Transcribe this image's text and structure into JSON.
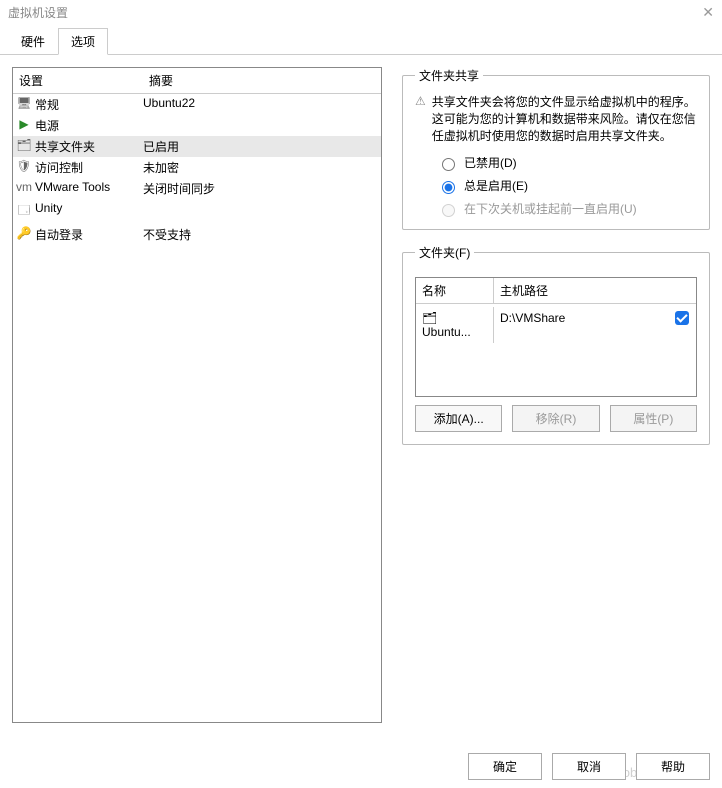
{
  "window": {
    "title": "虚拟机设置"
  },
  "tabs": {
    "hardware": "硬件",
    "options": "选项"
  },
  "list": {
    "header_setting": "设置",
    "header_summary": "摘要",
    "rows": [
      {
        "icon": "🖥",
        "label": "常规",
        "summary": "Ubuntu22"
      },
      {
        "icon": "▶",
        "label": "电源",
        "summary": ""
      },
      {
        "icon": "🗂",
        "label": "共享文件夹",
        "summary": "已启用"
      },
      {
        "icon": "🛡",
        "label": "访问控制",
        "summary": "未加密"
      },
      {
        "icon": "vm",
        "label": "VMware Tools",
        "summary": "关闭时间同步"
      },
      {
        "icon": "🗔",
        "label": "Unity",
        "summary": ""
      },
      {
        "icon": "🔑",
        "label": "自动登录",
        "summary": "不受支持"
      }
    ]
  },
  "sharing": {
    "legend": "文件夹共享",
    "warn_icon": "⚠",
    "warning": "共享文件夹会将您的文件显示给虚拟机中的程序。这可能为您的计算机和数据带来风险。请仅在您信任虚拟机时使用您的数据时启用共享文件夹。",
    "opt_disabled": "已禁用(D)",
    "opt_always": "总是启用(E)",
    "opt_until": "在下次关机或挂起前一直启用(U)"
  },
  "folders": {
    "legend": "文件夹(F)",
    "header_name": "名称",
    "header_path": "主机路径",
    "row": {
      "icon": "🗂",
      "name": "Ubuntu...",
      "path": "D:\\VMShare"
    },
    "btn_add": "添加(A)...",
    "btn_remove": "移除(R)",
    "btn_props": "属性(P)"
  },
  "footer": {
    "ok": "确定",
    "cancel": "取消",
    "help": "帮助"
  },
  "watermark": "CSDN @bobcat_kay"
}
